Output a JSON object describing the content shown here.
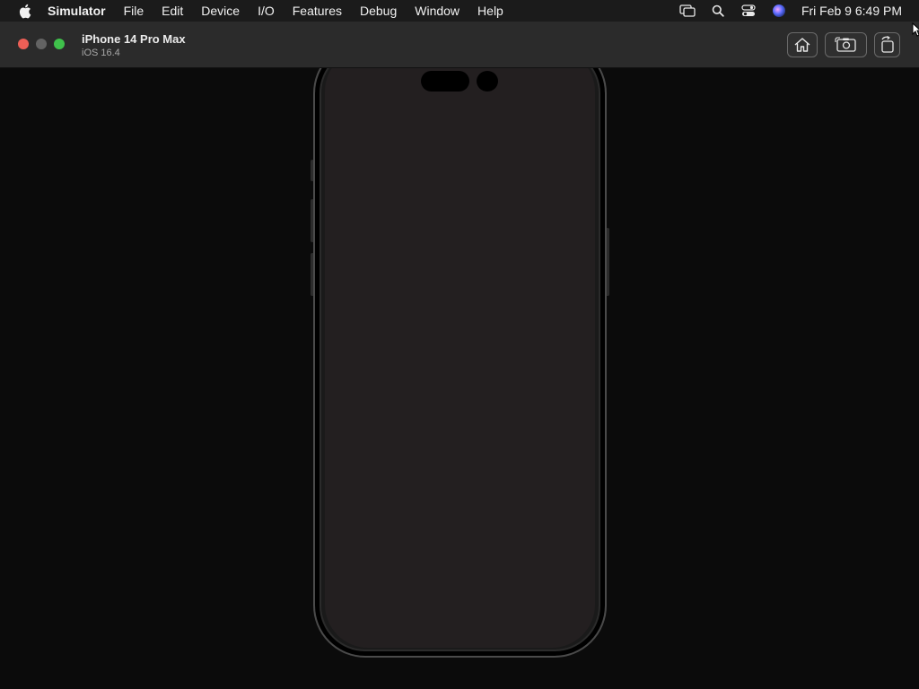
{
  "menubar": {
    "apple_icon": "apple-logo",
    "items": [
      "Simulator",
      "File",
      "Edit",
      "Device",
      "I/O",
      "Features",
      "Debug",
      "Window",
      "Help"
    ],
    "status_icons": [
      "screen-mirroring-icon",
      "spotlight-search-icon",
      "control-center-icon",
      "siri-icon"
    ],
    "clock": "Fri Feb 9  6:49 PM"
  },
  "window": {
    "device_name": "iPhone 14 Pro Max",
    "os_version": "iOS 16.4",
    "toolbar": {
      "home_icon": "home-icon",
      "screenshot_icon": "screenshot-icon",
      "rotate_icon": "rotate-icon"
    }
  },
  "colors": {
    "menubar_bg": "#1b1b1b",
    "titlebar_bg": "#2b2b2b",
    "stage_bg": "#0b0b0b",
    "screen_bg": "#231f20",
    "close": "#ec5f56",
    "minimize": "#636363",
    "zoom": "#3fc14b"
  }
}
